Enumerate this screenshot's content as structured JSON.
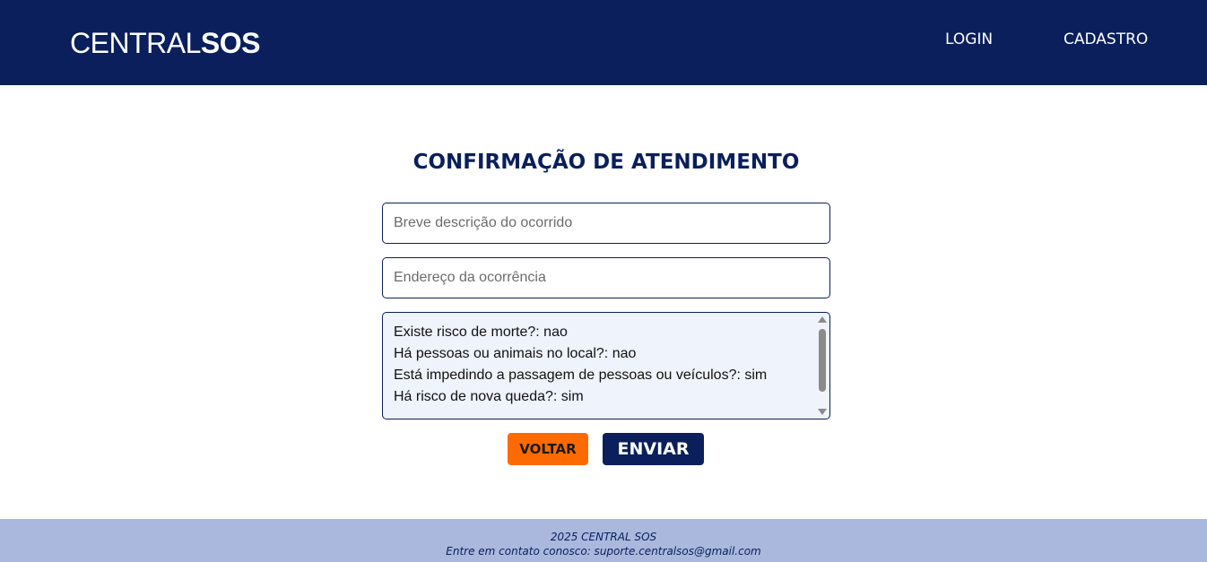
{
  "header": {
    "logo_light": "CENTRAL",
    "logo_bold": "SOS",
    "nav": {
      "login": "LOGIN",
      "cadastro": "CADASTRO"
    }
  },
  "main": {
    "title": "CONFIRMAÇÃO DE ATENDIMENTO",
    "description_placeholder": "Breve descrição do ocorrido",
    "address_placeholder": "Endereço da ocorrência",
    "answers": [
      "Existe risco de morte?: nao",
      "Há pessoas ou animais no local?: nao",
      "Está impedindo a passagem de pessoas ou veículos?: sim",
      "Há risco de nova queda?: sim"
    ],
    "buttons": {
      "back": "VOLTAR",
      "send": "ENVIAR"
    }
  },
  "footer": {
    "line1": "2025 CENTRAL SOS",
    "line2": "Entre em contato conosco: suporte.centralsos@gmail.com"
  },
  "colors": {
    "primary": "#0a1f5c",
    "accent": "#ff6a00",
    "footer_bg": "#aab8de",
    "textarea_bg": "#eef3fc"
  }
}
